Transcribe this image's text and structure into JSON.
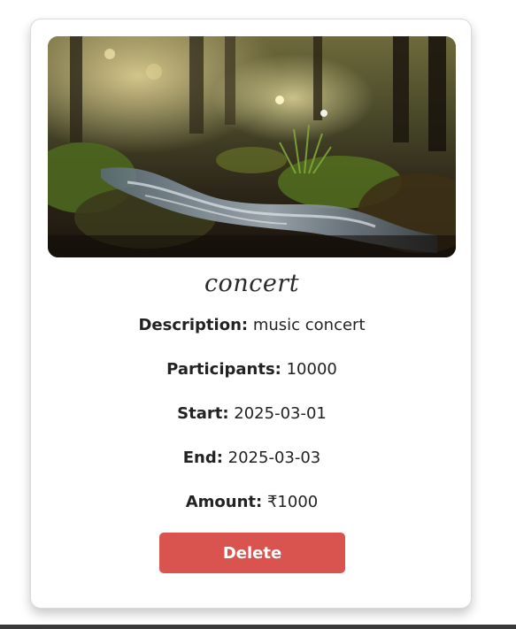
{
  "event": {
    "title": "concert",
    "description_label": "Description:",
    "description": "music concert",
    "participants_label": "Participants:",
    "participants": "10000",
    "start_label": "Start:",
    "start": "2025-03-01",
    "end_label": "End:",
    "end": "2025-03-03",
    "amount_label": "Amount:",
    "amount": "₹1000"
  },
  "actions": {
    "delete_label": "Delete"
  },
  "colors": {
    "delete_button": "#d9534f",
    "card_border": "#d9d9d9",
    "bottom_bar": "#3a3a3a"
  }
}
